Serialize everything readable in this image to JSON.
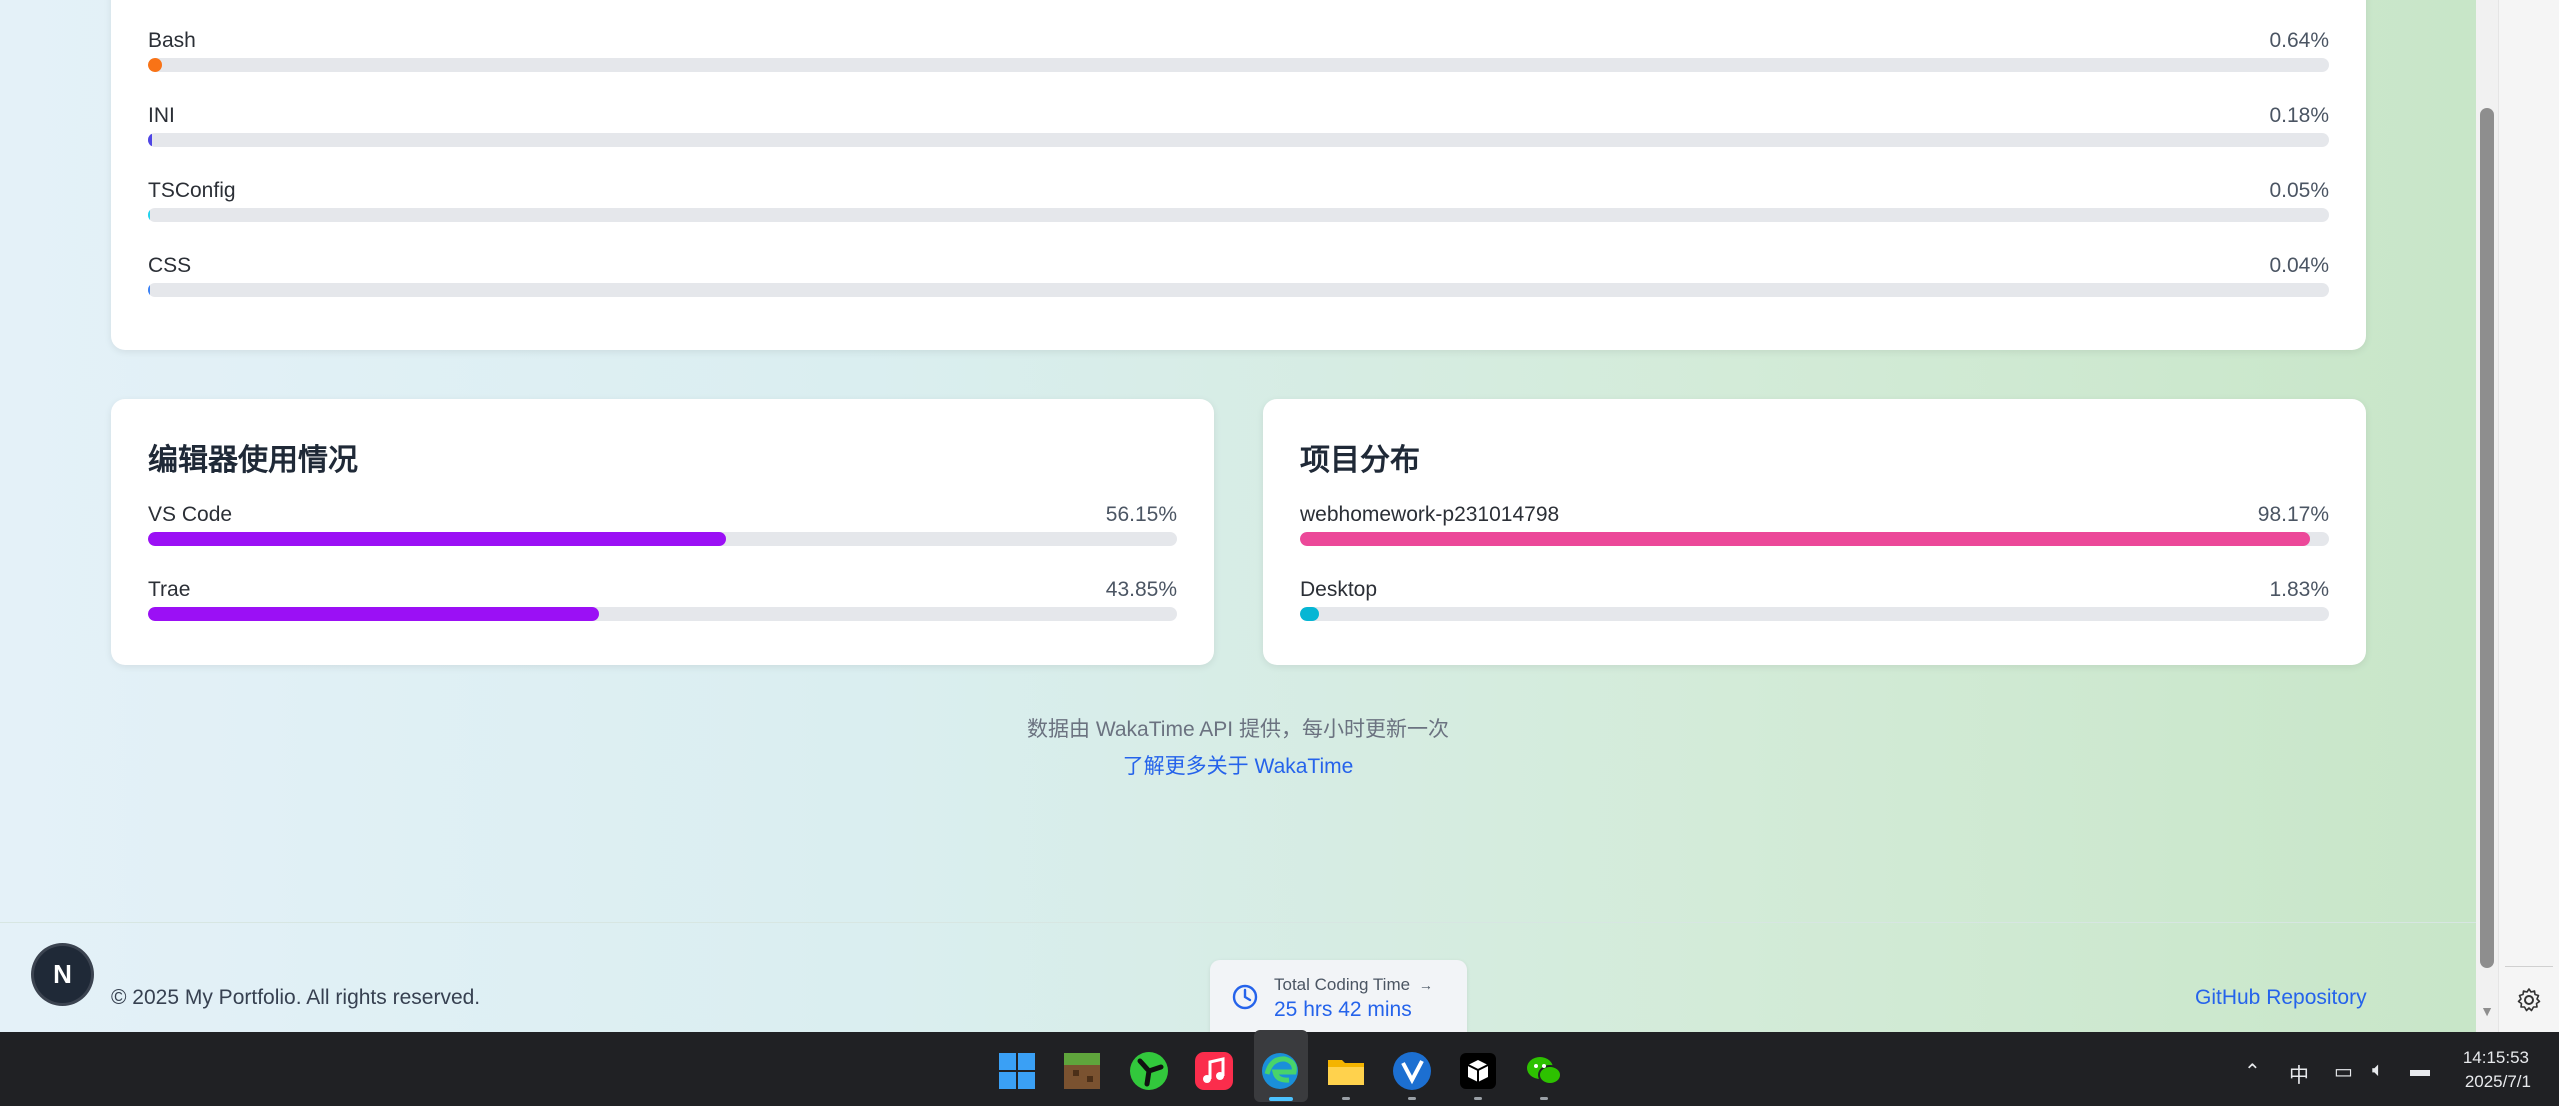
{
  "languages": [
    {
      "name": "",
      "percent": "",
      "color": "#06b6d4",
      "fraction": 0.011
    },
    {
      "name": "Bash",
      "percent": "0.64%",
      "color": "#f97316",
      "fraction": 0.0064
    },
    {
      "name": "INI",
      "percent": "0.18%",
      "color": "#4f46e5",
      "fraction": 0.0018
    },
    {
      "name": "TSConfig",
      "percent": "0.05%",
      "color": "#22d3ee",
      "fraction": 0.0005
    },
    {
      "name": "CSS",
      "percent": "0.04%",
      "color": "#3b82f6",
      "fraction": 0.0004
    }
  ],
  "editors": {
    "title": "编辑器使用情况",
    "items": [
      {
        "name": "VS Code",
        "percent": "56.15%",
        "color": "#9b10f5",
        "fraction": 0.5615
      },
      {
        "name": "Trae",
        "percent": "43.85%",
        "color": "#9b10f5",
        "fraction": 0.4385
      }
    ]
  },
  "projects": {
    "title": "项目分布",
    "items": [
      {
        "name": "webhomework-p231014798",
        "percent": "98.17%",
        "color": "#ec4899",
        "fraction": 0.9817
      },
      {
        "name": "Desktop",
        "percent": "1.83%",
        "color": "#06b6d4",
        "fraction": 0.0183
      }
    ]
  },
  "footer_note": {
    "text": "数据由 WakaTime API 提供，每小时更新一次",
    "link": "了解更多关于 WakaTime"
  },
  "footer": {
    "copyright": "© 2025 My Portfolio. All rights reserved.",
    "github": "GitHub Repository"
  },
  "coding_widget": {
    "label": "Total Coding Time",
    "arrow": "→",
    "value": "25 hrs 42 mins"
  },
  "avatar_letter": "N",
  "taskbar": {
    "apps": [
      "windows-start-icon",
      "minecraft-icon",
      "fan-app-icon",
      "music-icon",
      "edge-icon",
      "file-explorer-icon",
      "vscode-app-icon",
      "cube-app-icon",
      "wechat-icon"
    ],
    "ime": "中",
    "time": "14:15:53",
    "date": "2025/7/1"
  }
}
